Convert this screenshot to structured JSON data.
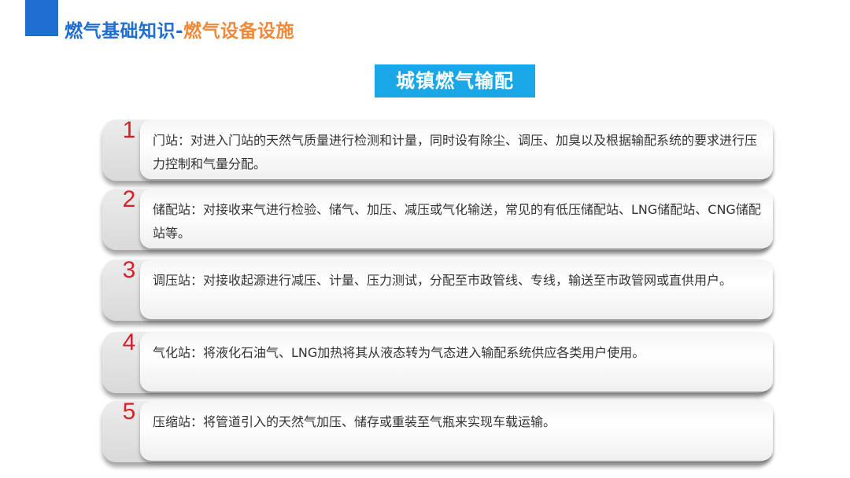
{
  "header": {
    "title_main": "燃气基础知识",
    "title_sep": "-",
    "title_sub": "燃气设备设施"
  },
  "section": {
    "title": "城镇燃气输配"
  },
  "items": [
    {
      "num": "1",
      "text": "门站：对进入门站的天然气质量进行检测和计量，同时设有除尘、调压、加臭以及根据输配系统的要求进行压力控制和气量分配。"
    },
    {
      "num": "2",
      "text": "储配站：对接收来气进行检验、储气、加压、减压或气化输送，常见的有低压储配站、LNG储配站、CNG储配站等。"
    },
    {
      "num": "3",
      "text": "调压站：对接收起源进行减压、计量、压力测试，分配至市政管线、专线，输送至市政管网或直供用户。"
    },
    {
      "num": "4",
      "text": "气化站：将液化石油气、LNG加热将其从液态转为气态进入输配系统供应各类用户使用。"
    },
    {
      "num": "5",
      "text": "压缩站：将管道引入的天然气加压、储存或重装至气瓶来实现车载运输。"
    }
  ],
  "colors": {
    "header_blue": "#1f6fd0",
    "header_orange": "#f08a3a",
    "section_bg": "#1aa7e8",
    "number_red": "#d8202a"
  }
}
